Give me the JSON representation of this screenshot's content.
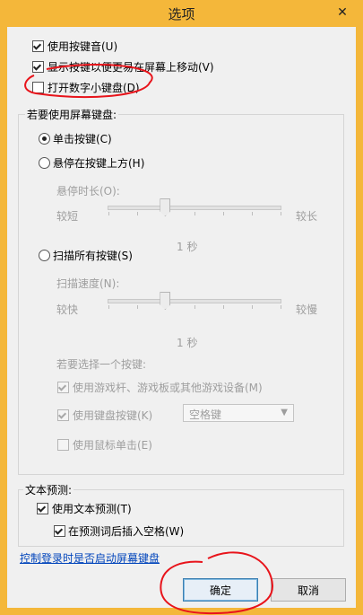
{
  "window": {
    "title": "选项",
    "close_glyph": "✕"
  },
  "options": {
    "click_sound": {
      "label": "使用按键音(U)",
      "checked": true
    },
    "show_keys": {
      "label": "显示按键以便更易在屏幕上移动(V)",
      "checked": true
    },
    "numpad": {
      "label": "打开数字小键盘(D)",
      "checked": false
    }
  },
  "keyboard_group": {
    "title": "若要使用屏幕键盘:",
    "click_keys": {
      "label": "单击按键(C)",
      "selected": true
    },
    "hover_keys": {
      "label": "悬停在按键上方(H)",
      "selected": false
    },
    "hover_duration": {
      "label": "悬停时长(O):",
      "min_label": "较短",
      "max_label": "较长",
      "value_label": "1 秒",
      "position": 0.33
    },
    "scan_keys": {
      "label": "扫描所有按键(S)",
      "selected": false
    },
    "scan_speed": {
      "label": "扫描速度(N):",
      "min_label": "较快",
      "max_label": "较慢",
      "value_label": "1 秒",
      "position": 0.33
    },
    "select_key_title": "若要选择一个按键:",
    "use_gamepad": {
      "label": "使用游戏杆、游戏板或其他游戏设备(M)",
      "checked": true
    },
    "use_keyboard_key": {
      "label": "使用键盘按键(K)",
      "checked": true,
      "value": "空格键"
    },
    "use_mouse_click": {
      "label": "使用鼠标单击(E)",
      "checked": false
    }
  },
  "text_prediction": {
    "title": "文本预测:",
    "use_prediction": {
      "label": "使用文本预测(T)",
      "checked": true
    },
    "insert_space": {
      "label": "在预测词后插入空格(W)",
      "checked": true
    }
  },
  "startup_link": "控制登录时是否启动屏幕键盘",
  "buttons": {
    "ok": "确定",
    "cancel": "取消"
  },
  "colors": {
    "title_bar": "#f4b73a",
    "annotation": "#e8141b",
    "link": "#0044bb"
  }
}
